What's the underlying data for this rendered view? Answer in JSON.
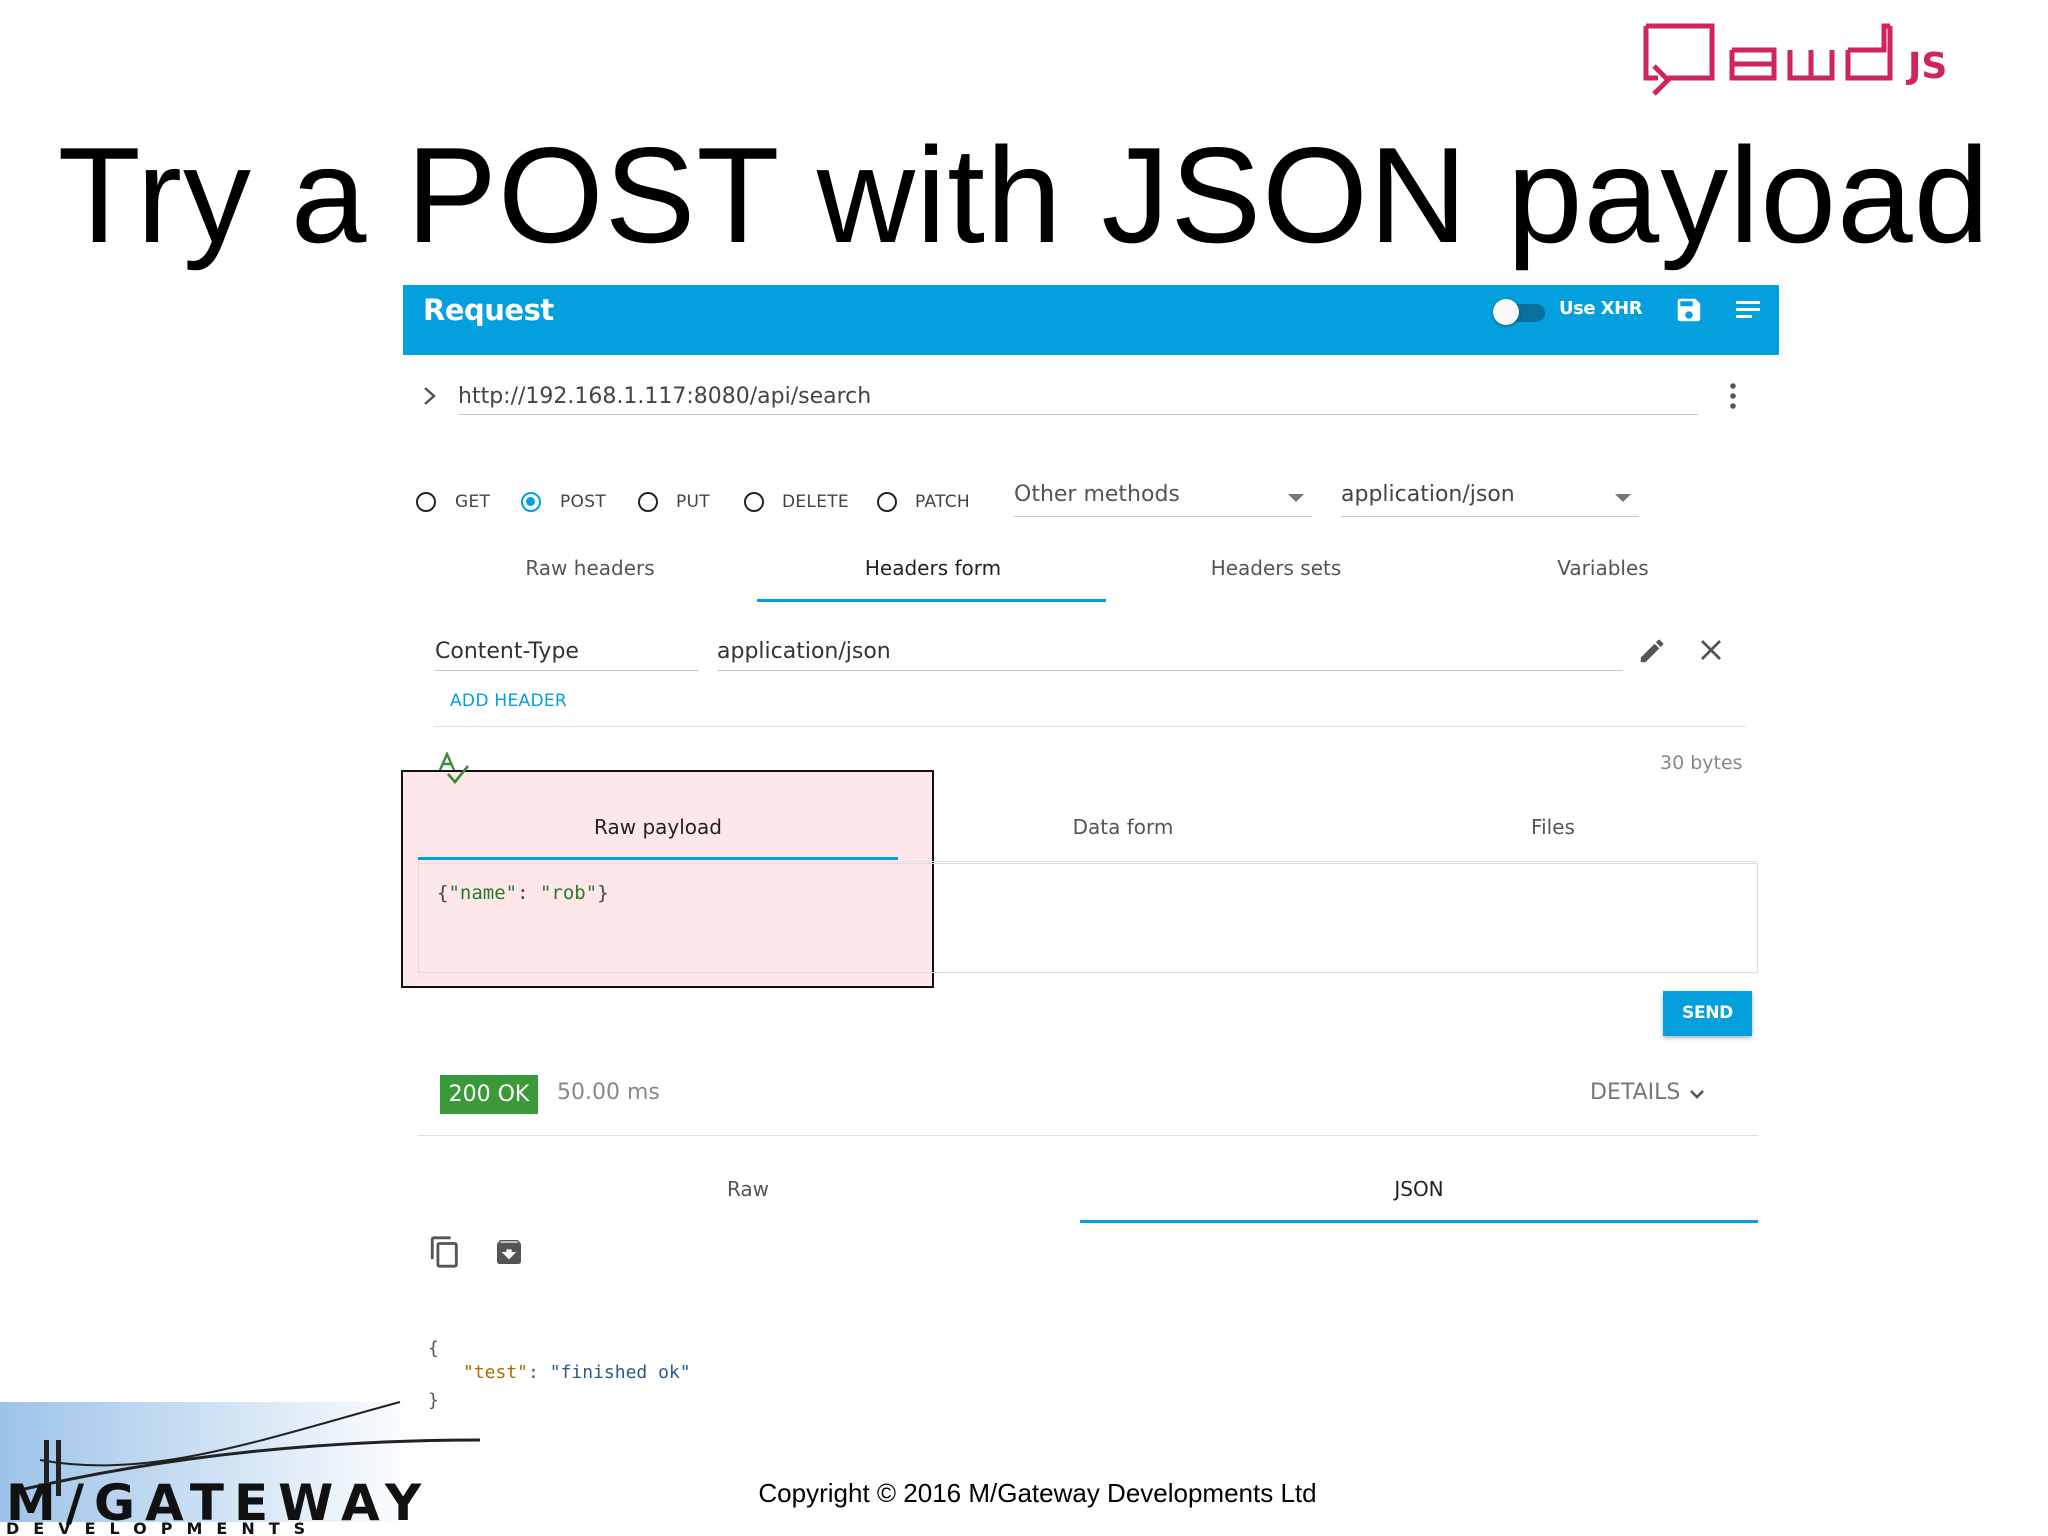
{
  "slide": {
    "title": "Try a POST with JSON payload",
    "logo_text": "qewd",
    "logo_suffix": "JS",
    "copyright": "Copyright © 2016 M/Gateway Developments Ltd",
    "company_logo_top": "M/GATEWAY",
    "company_logo_bottom": "DEVELOPMENTS"
  },
  "request": {
    "title": "Request",
    "use_xhr_label": "Use XHR",
    "use_xhr_on": false,
    "url": "http://192.168.1.117:8080/api/search",
    "methods": [
      "GET",
      "POST",
      "PUT",
      "DELETE",
      "PATCH"
    ],
    "selected_method": "POST",
    "other_methods_label": "Other methods",
    "content_type_select": "application/json",
    "header_tabs": [
      "Raw headers",
      "Headers form",
      "Headers sets",
      "Variables"
    ],
    "active_header_tab": "Headers form",
    "headers": [
      {
        "name": "Content-Type",
        "value": "application/json"
      }
    ],
    "add_header_label": "ADD HEADER",
    "payload_size": "30 bytes",
    "payload_tabs": [
      "Raw payload",
      "Data form",
      "Files"
    ],
    "active_payload_tab": "Raw payload",
    "payload": {
      "open": "{",
      "key": "\"name\"",
      "colon": ": ",
      "value": "\"rob\"",
      "close": "}"
    },
    "send_label": "SEND"
  },
  "response": {
    "status": "200 OK",
    "time": "50.00 ms",
    "details_label": "DETAILS",
    "tabs": [
      "Raw",
      "JSON"
    ],
    "active_tab": "JSON",
    "body": {
      "open": "{",
      "key": "\"test\"",
      "colon": ": ",
      "value": "\"finished ok\"",
      "close": "}"
    }
  },
  "colors": {
    "accent": "#03a0dd",
    "status_ok": "#3a9a3a",
    "highlight_fill": "#fde7e9",
    "logo": "#d0245e",
    "json_key": "#b36a00",
    "json_string": "#2a7a2a"
  }
}
